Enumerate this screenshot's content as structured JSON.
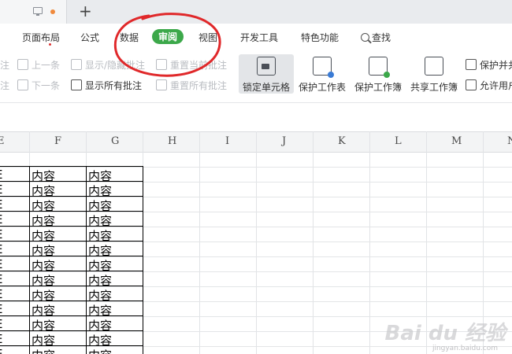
{
  "tabbar": {
    "new_tab": "+"
  },
  "menu": {
    "items": [
      "页面布局",
      "公式",
      "数据",
      "审阅",
      "视图",
      "开发工具",
      "特色功能",
      "查找"
    ]
  },
  "ribbon": {
    "prev_comment": "上一条",
    "next_comment": "下一条",
    "toggle_comment": "显示/隐藏批注",
    "show_all_comments": "显示所有批注",
    "reset_current_comment": "重置当前批注",
    "reset_all_comments": "重置所有批注",
    "lock_cell": "锁定单元格",
    "protect_sheet": "保护工作表",
    "protect_workbook": "保护工作簿",
    "share_workbook": "共享工作簿",
    "protect_share": "保护并共",
    "allow_edit": "允许用户"
  },
  "columns": [
    "E",
    "F",
    "G",
    "H",
    "I",
    "J",
    "K",
    "L",
    "M",
    "N"
  ],
  "cells": {
    "value": "内容",
    "partial": "E"
  },
  "watermark": {
    "main": "Bai du 经验",
    "sub": "jingyan.baidu.com"
  },
  "colors": {
    "accent": "#3ca84a",
    "annotation": "#e0282a"
  }
}
